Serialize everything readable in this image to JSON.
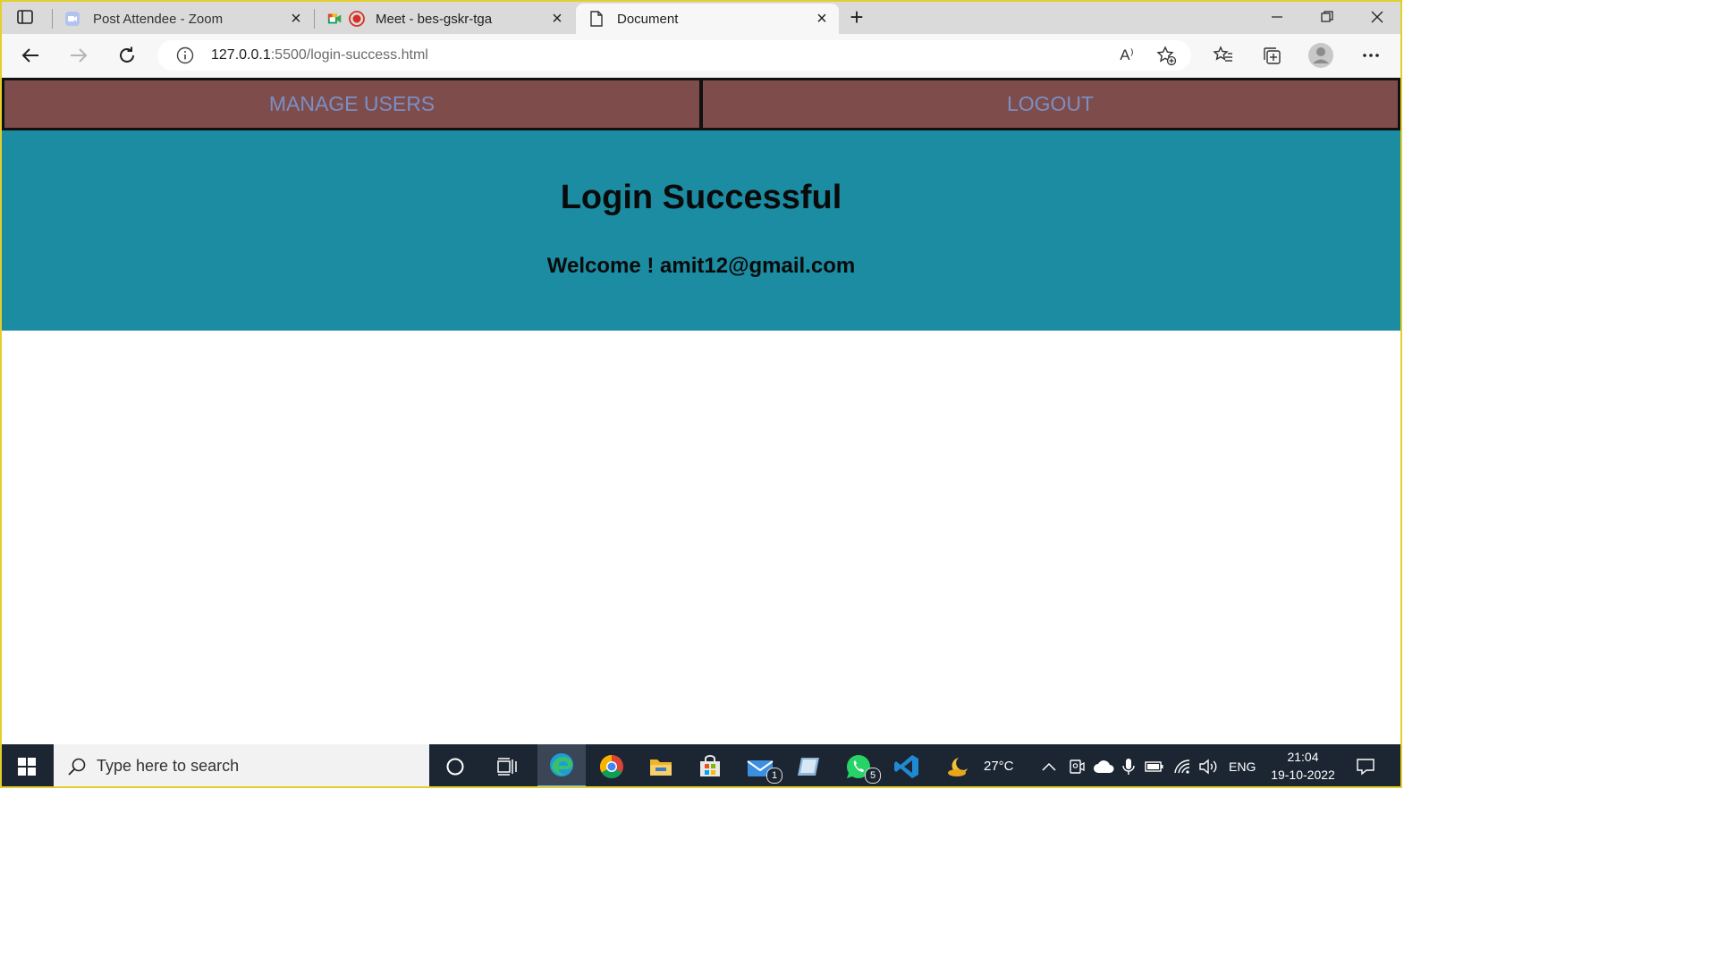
{
  "browser": {
    "tabs": [
      {
        "title": "Post Attendee - Zoom",
        "icon": "zoom-icon",
        "active": false
      },
      {
        "title": "Meet - bes-gskr-tga",
        "icon": "google-meet-icon",
        "active": false
      },
      {
        "title": "Document",
        "icon": "document-icon",
        "active": true
      }
    ],
    "new_tab_label": "+",
    "address": {
      "host": "127.0.0.1",
      "path": ":5500/login-success.html",
      "read_aloud_label": "A⁾"
    }
  },
  "page": {
    "nav": {
      "manage_users": "MANAGE USERS",
      "logout": "LOGOUT"
    },
    "heading": "Login Successful",
    "welcome": "Welcome ! amit12@gmail.com",
    "colors": {
      "nav_bg": "#7f4c4c",
      "nav_text": "#7b8fc3",
      "hero_bg": "#1b8ca2"
    }
  },
  "taskbar": {
    "search_placeholder": "Type here to search",
    "mail_badge": "1",
    "whatsapp_badge": "5",
    "weather": "27°C",
    "language": "ENG",
    "time": "21:04",
    "date": "19-10-2022"
  }
}
